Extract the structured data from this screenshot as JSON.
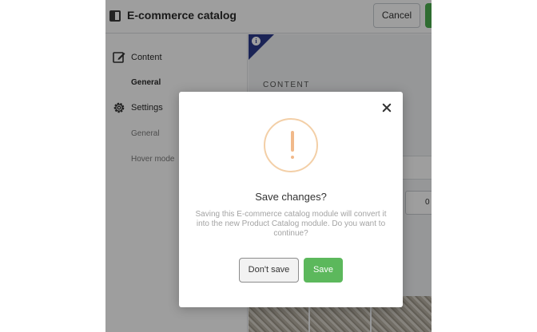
{
  "header": {
    "title": "E-commerce catalog",
    "cancel_label": "Cancel"
  },
  "sidebar": {
    "items": [
      {
        "label": "Content",
        "icon": "edit-icon"
      },
      {
        "label": "General",
        "sub": true
      },
      {
        "label": "Settings",
        "icon": "gear-icon"
      },
      {
        "label": "General",
        "sub": true
      },
      {
        "label": "Hover mode",
        "sub": true
      }
    ]
  },
  "content": {
    "heading": "CONTENT",
    "number_value": "0"
  },
  "modal": {
    "title": "Save changes?",
    "message": "Saving this E-commerce catalog module will convert it into the new Product Catalog module. Do you want to continue?",
    "dont_save_label": "Don't save",
    "save_label": "Save"
  },
  "colors": {
    "accent_green": "#5cb85c",
    "info_blue": "#2c3a8c",
    "warning_orange": "#f1b98a"
  }
}
